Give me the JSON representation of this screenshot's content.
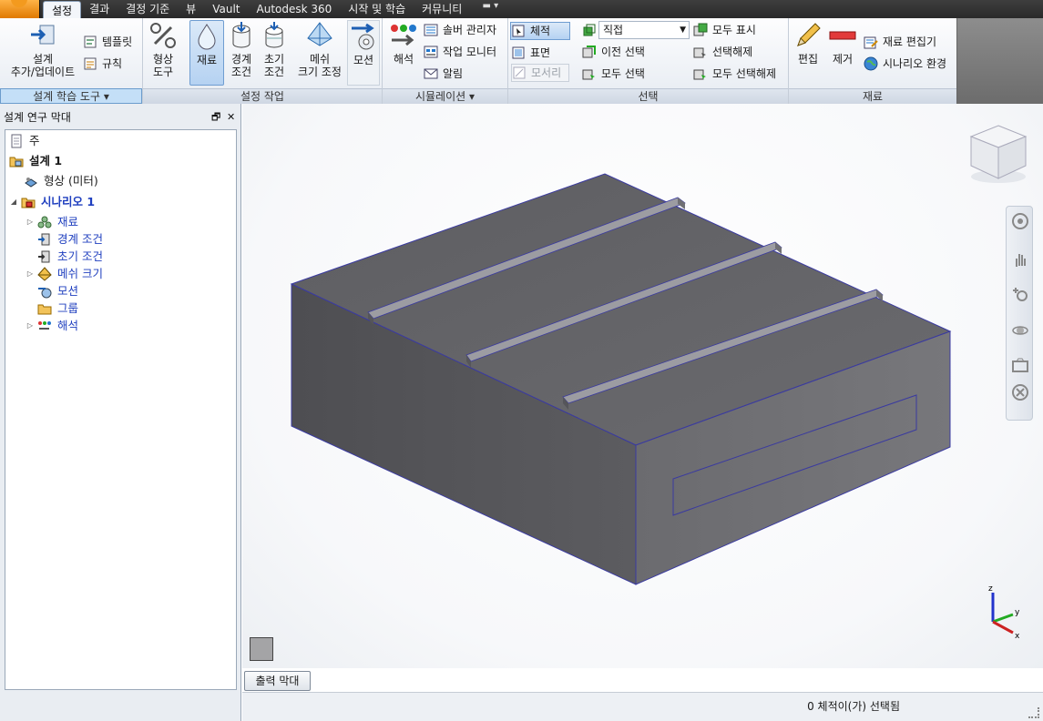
{
  "menubar": {
    "tabs": [
      "설정",
      "결과",
      "결정 기준",
      "뷰",
      "Vault",
      "Autodesk 360",
      "시작 및 학습",
      "커뮤니티"
    ],
    "active_tab": "설정"
  },
  "ribbon": {
    "panels": {
      "design_study": {
        "title": "설계 학습 도구 ▾",
        "add_update": "설계\n추가/업데이트",
        "add_update_l1": "설계",
        "add_update_l2": "추가/업데이트",
        "template": "템플릿",
        "rules": "규칙"
      },
      "setup": {
        "title": "설정 작업",
        "geometry_l1": "형상",
        "geometry_l2": "도구",
        "material": "재료",
        "boundary_l1": "경계",
        "boundary_l2": "조건",
        "initial_l1": "초기",
        "initial_l2": "조건",
        "mesh_l1": "메쉬",
        "mesh_l2": "크기 조정",
        "motion": "모션"
      },
      "simulation": {
        "title": "시뮬레이션 ▾",
        "solve": "해석",
        "solver_manager": "솔버 관리자",
        "job_monitor": "작업 모니터",
        "notification": "알림"
      },
      "selection": {
        "title": "선택",
        "volume": "체적",
        "surface": "표면",
        "edge": "모서리",
        "mode_value": "직접",
        "previous": "이전 선택",
        "select_all": "모두 선택",
        "show_all": "모두 표시",
        "deselect": "선택해제",
        "deselect_all": "모두 선택해제"
      },
      "material": {
        "title": "재료",
        "edit": "편집",
        "remove": "제거",
        "editor": "재료 편집기",
        "environment": "시나리오 환경"
      }
    }
  },
  "browser": {
    "title": "설계 연구 막대",
    "tree": [
      {
        "label": "주",
        "style": "normal"
      },
      {
        "label": "설계 1",
        "style": "bold"
      },
      {
        "label": "형상 (미터)",
        "style": "normal"
      },
      {
        "label": "시나리오 1",
        "style": "bold-blue"
      },
      {
        "label": "재료",
        "style": "blue"
      },
      {
        "label": "경계 조건",
        "style": "blue"
      },
      {
        "label": "초기 조건",
        "style": "blue"
      },
      {
        "label": "메쉬 크기",
        "style": "blue"
      },
      {
        "label": "모션",
        "style": "blue"
      },
      {
        "label": "그룹",
        "style": "blue"
      },
      {
        "label": "해석",
        "style": "blue"
      }
    ]
  },
  "viewport": {
    "triad_labels": {
      "x": "x",
      "y": "y",
      "z": "z"
    }
  },
  "output_button": "출력 막대",
  "status": "0 체적이(가) 선택됨",
  "colors": {
    "model_face": "#6b6b6f",
    "model_edge": "#3a3aa0",
    "rib": "#9a9aa0",
    "selection_blue": "#b5d2f2"
  }
}
